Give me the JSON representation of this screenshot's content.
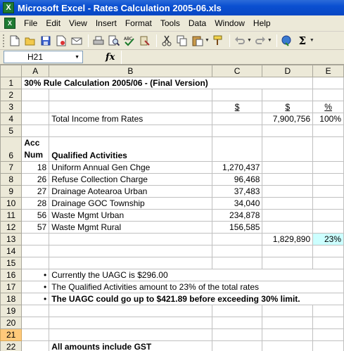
{
  "window": {
    "title": "Microsoft Excel - Rates Calculation 2005-06.xls",
    "icon_letter": "X"
  },
  "menu": {
    "items": [
      {
        "label": "File"
      },
      {
        "label": "Edit"
      },
      {
        "label": "View"
      },
      {
        "label": "Insert"
      },
      {
        "label": "Format"
      },
      {
        "label": "Tools"
      },
      {
        "label": "Data"
      },
      {
        "label": "Window"
      },
      {
        "label": "Help"
      }
    ]
  },
  "formula_bar": {
    "name_box": "H21",
    "fx_label": "fx",
    "formula": ""
  },
  "columns": [
    "A",
    "B",
    "C",
    "D",
    "E"
  ],
  "rows": [
    {
      "num": "1",
      "a": "30% Rule Calculation 2005/06 - (Final Version)",
      "b": "",
      "c": "",
      "d": "",
      "e": ""
    },
    {
      "num": "2",
      "a": "",
      "b": "",
      "c": "",
      "d": "",
      "e": ""
    },
    {
      "num": "3",
      "a": "",
      "b": "",
      "c": "$",
      "d": "$",
      "e": "%"
    },
    {
      "num": "4",
      "a": "",
      "b": "Total Income from Rates",
      "c": "",
      "d": "7,900,756",
      "e": "100%"
    },
    {
      "num": "5",
      "a": "",
      "b": "",
      "c": "",
      "d": "",
      "e": ""
    },
    {
      "num": "6",
      "a": "Acc Num",
      "a1": "Acc",
      "a2": "Num",
      "b": "Qualified Activities",
      "c": "",
      "d": "",
      "e": ""
    },
    {
      "num": "7",
      "a": "18",
      "b": "Uniform Annual Gen Chge",
      "c": "1,270,437",
      "d": "",
      "e": ""
    },
    {
      "num": "8",
      "a": "26",
      "b": "Refuse Collection Charge",
      "c": "96,468",
      "d": "",
      "e": ""
    },
    {
      "num": "9",
      "a": "27",
      "b": "Drainage Aotearoa Urban",
      "c": "37,483",
      "d": "",
      "e": ""
    },
    {
      "num": "10",
      "a": "28",
      "b": "Drainage GOC Township",
      "c": "34,040",
      "d": "",
      "e": ""
    },
    {
      "num": "11",
      "a": "56",
      "b": "Waste Mgmt Urban",
      "c": "234,878",
      "d": "",
      "e": ""
    },
    {
      "num": "12",
      "a": "57",
      "b": "Waste Mgmt Rural",
      "c": "156,585",
      "d": "",
      "e": ""
    },
    {
      "num": "13",
      "a": "",
      "b": "",
      "c": "",
      "d": "1,829,890",
      "e": "23%"
    },
    {
      "num": "14",
      "a": "",
      "b": "",
      "c": "",
      "d": "",
      "e": ""
    },
    {
      "num": "15",
      "a": "",
      "b": "",
      "c": "",
      "d": "",
      "e": ""
    },
    {
      "num": "16",
      "a": "•",
      "b": "Currently the UAGC is $296.00",
      "c": "",
      "d": "",
      "e": ""
    },
    {
      "num": "17",
      "a": "•",
      "b": "The Qualified Activities amount to 23% of the total rates",
      "c": "",
      "d": "",
      "e": ""
    },
    {
      "num": "18",
      "a": "•",
      "b": "The UAGC could go up to $421.89 before exceeding 30% limit.",
      "c": "",
      "d": "",
      "e": ""
    },
    {
      "num": "19",
      "a": "",
      "b": "",
      "c": "",
      "d": "",
      "e": ""
    },
    {
      "num": "20",
      "a": "",
      "b": "",
      "c": "",
      "d": "",
      "e": ""
    },
    {
      "num": "21",
      "a": "",
      "b": "",
      "c": "",
      "d": "",
      "e": ""
    },
    {
      "num": "22",
      "a": "",
      "b": "All amounts include GST",
      "c": "",
      "d": "",
      "e": ""
    }
  ],
  "colors": {
    "title_bar": "#0a4fd1",
    "selected_row_header": "#ffc97a",
    "highlight_cell": "#ccffff"
  }
}
